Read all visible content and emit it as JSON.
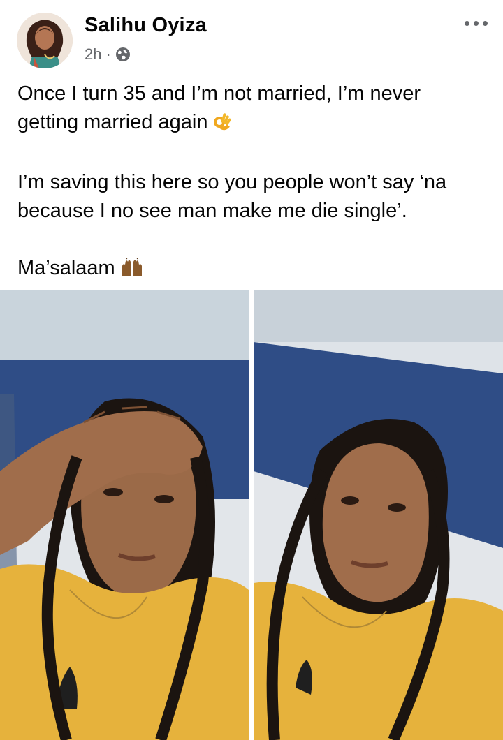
{
  "post": {
    "author": "Salihu Oyiza",
    "time": "2h",
    "separator": "·",
    "privacy_icon": "globe-icon",
    "menu_icon": "more-options-icon",
    "text_line1": "Once I turn 35 and I’m not married, I’m never getting married again",
    "text_line2": "I’m saving this here so you people won’t say ‘na because I no see man make me die single’.",
    "text_line3": "Ma’salaam",
    "emoji1": "ok-hand-emoji",
    "emoji2": "raising-hands-emoji"
  },
  "photos": [
    {
      "subject": "selfie-left"
    },
    {
      "subject": "selfie-right"
    }
  ],
  "colors": {
    "text": "#050505",
    "secondary_text": "#65676b",
    "wall_blue": "#2f4d86",
    "shirt_yellow": "#e6b23c"
  }
}
